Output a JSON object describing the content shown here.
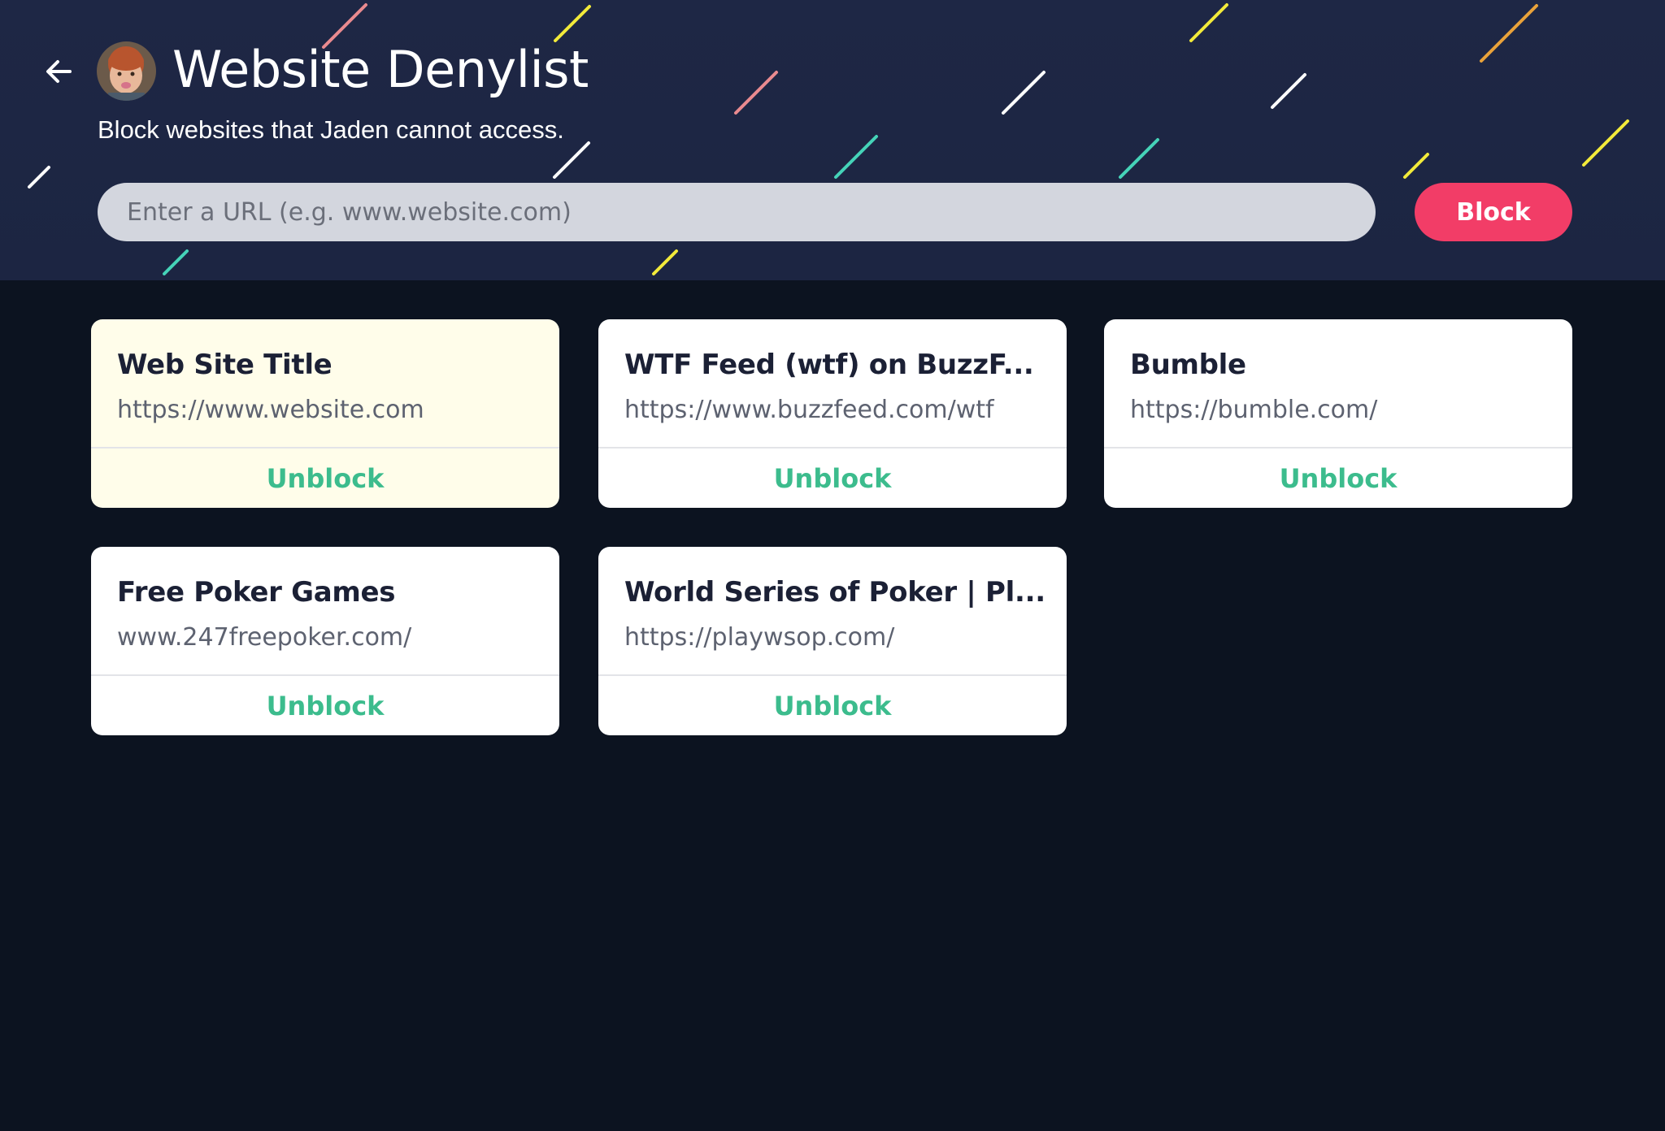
{
  "header": {
    "back_icon": "arrow-left-icon",
    "avatar": "child-avatar",
    "title": "Website Denylist",
    "subtitle": "Block websites that Jaden cannot access.",
    "url_placeholder": "Enter a URL (e.g. www.website.com)",
    "block_label": "Block"
  },
  "colors": {
    "header_bg": "#1e2745",
    "page_bg": "#0c1320",
    "accent": "#f23d67",
    "unblock": "#3cbc8d",
    "highlight_card": "#fffdea"
  },
  "sites": [
    {
      "title": "Web Site Title",
      "url": "https://www.website.com",
      "action": "Unblock",
      "highlighted": true
    },
    {
      "title": "WTF Feed (wtf) on BuzzF...",
      "url": "https://www.buzzfeed.com/wtf",
      "action": "Unblock",
      "highlighted": false
    },
    {
      "title": "Bumble",
      "url": "https://bumble.com/",
      "action": "Unblock",
      "highlighted": false
    },
    {
      "title": "Free Poker Games",
      "url": "www.247freepoker.com/",
      "action": "Unblock",
      "highlighted": false
    },
    {
      "title": "World Series of Poker | Pl...",
      "url": "https://playwsop.com/",
      "action": "Unblock",
      "highlighted": false
    }
  ]
}
